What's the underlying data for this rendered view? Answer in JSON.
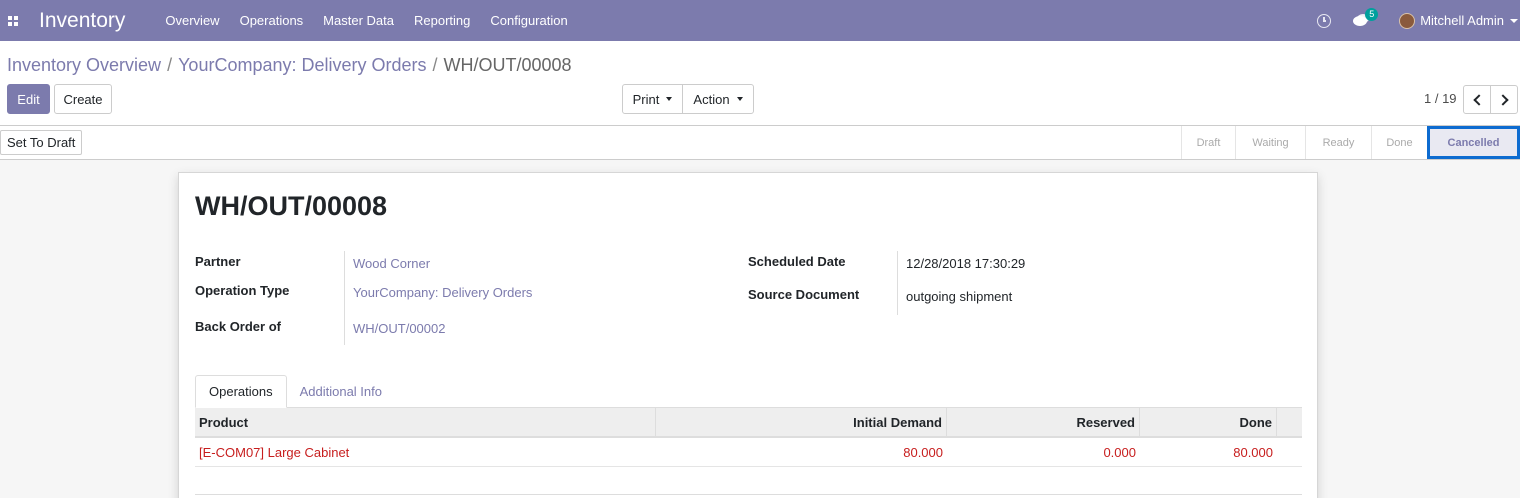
{
  "navbar": {
    "app_name": "Inventory",
    "menu": [
      "Overview",
      "Operations",
      "Master Data",
      "Reporting",
      "Configuration"
    ],
    "chat_badge": "5",
    "user_name": "Mitchell Admin"
  },
  "breadcrumb": {
    "items": [
      "Inventory Overview",
      "YourCompany: Delivery Orders"
    ],
    "sep": "/",
    "current": "WH/OUT/00008"
  },
  "buttons": {
    "edit": "Edit",
    "create": "Create",
    "print": "Print",
    "action": "Action"
  },
  "pager": {
    "value": "1 / 19"
  },
  "statusbar": {
    "set_to_draft": "Set To Draft",
    "stages": [
      "Draft",
      "Waiting",
      "Ready",
      "Done",
      "Cancelled"
    ],
    "active_stage": "Cancelled"
  },
  "record": {
    "title": "WH/OUT/00008",
    "fields": {
      "partner_label": "Partner",
      "partner_value": "Wood Corner",
      "operation_type_label": "Operation Type",
      "operation_type_value": "YourCompany: Delivery Orders",
      "back_order_label": "Back Order of",
      "back_order_value": "WH/OUT/00002",
      "scheduled_date_label": "Scheduled Date",
      "scheduled_date_value": "12/28/2018 17:30:29",
      "source_document_label": "Source Document",
      "source_document_value": "outgoing shipment"
    }
  },
  "tabs": [
    "Operations",
    "Additional Info"
  ],
  "table": {
    "columns": [
      "Product",
      "Initial Demand",
      "Reserved",
      "Done"
    ],
    "rows": [
      {
        "product": "[E-COM07] Large Cabinet",
        "initial_demand": "80.000",
        "reserved": "0.000",
        "done": "80.000"
      }
    ]
  },
  "colors": {
    "brand": "#7c7bad",
    "active_stage_border": "#0d6bd0",
    "cancelled_row_text": "#c71e1e"
  }
}
